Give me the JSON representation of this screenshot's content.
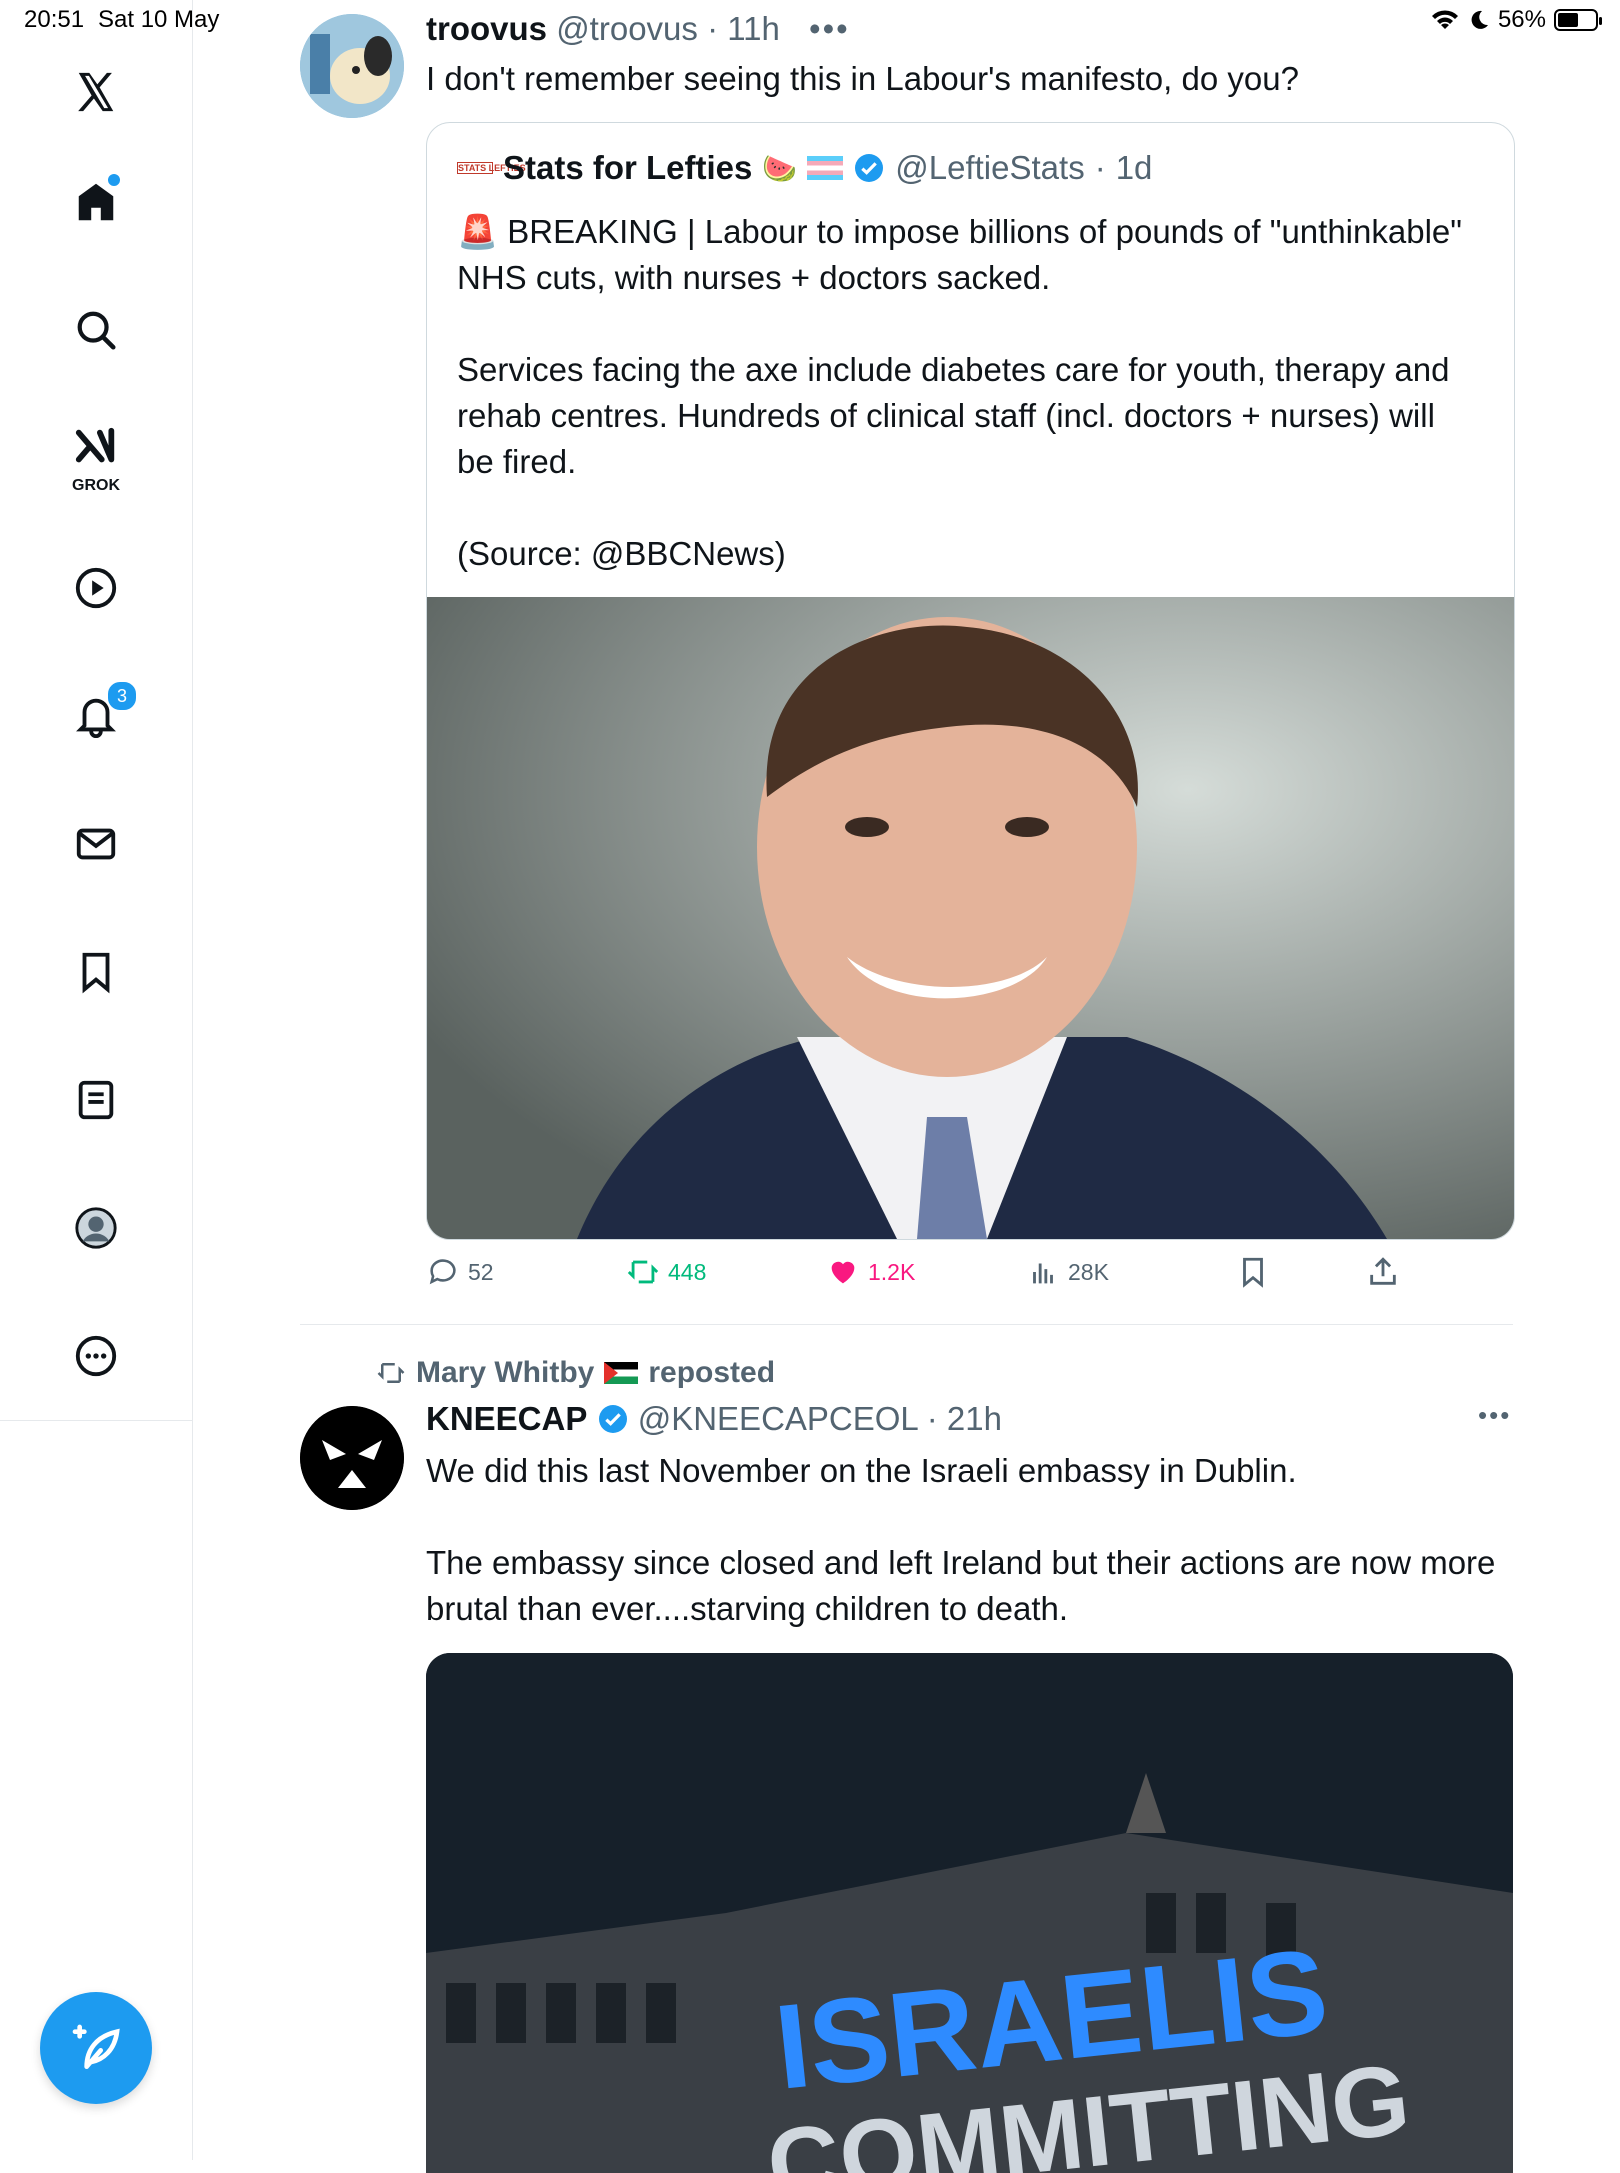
{
  "status": {
    "time": "20:51",
    "date": "Sat 10 May",
    "battery": "56%",
    "battery_level": 0.56
  },
  "sidebar": {
    "items": [
      {
        "name": "x-logo-icon"
      },
      {
        "name": "home-icon"
      },
      {
        "name": "search-icon"
      },
      {
        "name": "grok-icon",
        "label": "GROK"
      },
      {
        "name": "video-icon"
      },
      {
        "name": "notifications-icon",
        "badge": "3"
      },
      {
        "name": "messages-icon"
      },
      {
        "name": "bookmarks-icon"
      },
      {
        "name": "lists-icon"
      },
      {
        "name": "profile-icon"
      },
      {
        "name": "more-icon"
      }
    ],
    "compose": "compose-icon"
  },
  "tweet1": {
    "name": "troovus",
    "handle": "@troovus",
    "time": "11h",
    "text": "I don't remember seeing this in Labour's manifesto, do you?",
    "quote": {
      "logo": "STATS LEFTIES",
      "name": "Stats for Lefties",
      "handle": "@LeftieStats",
      "time": "1d",
      "text": "🚨 BREAKING | Labour to impose billions of pounds of \"unthinkable\" NHS cuts, with nurses + doctors sacked.\n\nServices facing the axe include diabetes care for youth,  therapy and rehab centres. Hundreds of clinical staff (incl. doctors + nurses) will be fired.\n\n(Source: @BBCNews)"
    },
    "actions": {
      "replies": "52",
      "reposts": "448",
      "likes": "1.2K",
      "views": "28K"
    }
  },
  "tweet2": {
    "repost_by": "Mary Whitby",
    "repost_label": "reposted",
    "name": "KNEECAP",
    "handle": "@KNEECAPCEOL",
    "time": "21h",
    "text": "We did this last November on the Israeli embassy in Dublin.\n\nThe embassy since closed and left Ireland but their actions are now more brutal than ever....starving children to death.",
    "image_text_1": "ISRAELIS",
    "image_text_2": "COMMITTING"
  },
  "colors": {
    "accent": "#1d9bf0",
    "like": "#f91880",
    "repost": "#00ba7c",
    "muted": "#536471"
  }
}
